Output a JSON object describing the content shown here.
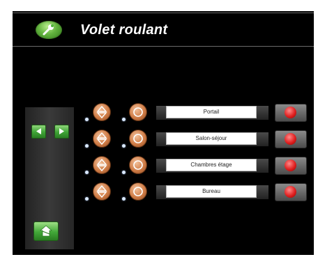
{
  "header": {
    "title": "Volet roulant",
    "settings_icon": "wrench-icon"
  },
  "navigation": {
    "prev_icon": "triangle-left-icon",
    "next_icon": "triangle-right-icon",
    "home_icon": "home-icon"
  },
  "shutters": [
    {
      "label": "Portail"
    },
    {
      "label": "Salon-séjour"
    },
    {
      "label": "Chambres étage"
    },
    {
      "label": "Bureau"
    }
  ],
  "colors": {
    "accent_green": "#4fb23a",
    "control_orange": "#cf7c46",
    "stop_red": "#e02020",
    "background": "#000000"
  }
}
